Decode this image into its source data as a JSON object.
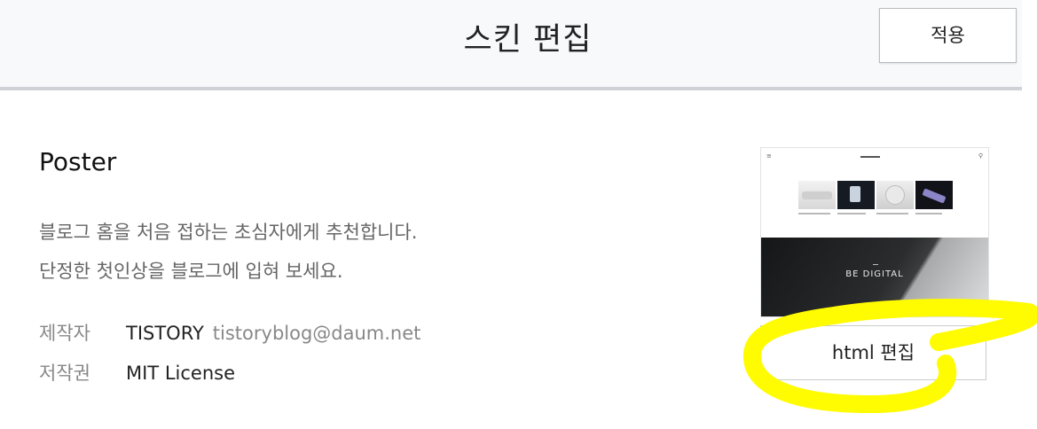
{
  "header": {
    "title": "스킨 편집",
    "apply_label": "적용"
  },
  "skin": {
    "name": "Poster",
    "description": [
      "블로그 홈을 처음 접하는 초심자에게 추천합니다.",
      "단정한 첫인상을 블로그에 입혀 보세요."
    ],
    "meta": {
      "author_label": "제작자",
      "author": "TISTORY",
      "email": "tistoryblog@daum.net",
      "license_label": "저작권",
      "license": "MIT License"
    },
    "thumbnail": {
      "hero_text": "BE DIGITAL"
    },
    "html_edit_label": "html 편집"
  },
  "colors": {
    "highlight": "#fffb00",
    "header_bg": "#f8f9fb",
    "header_border": "#cfd2d6"
  }
}
